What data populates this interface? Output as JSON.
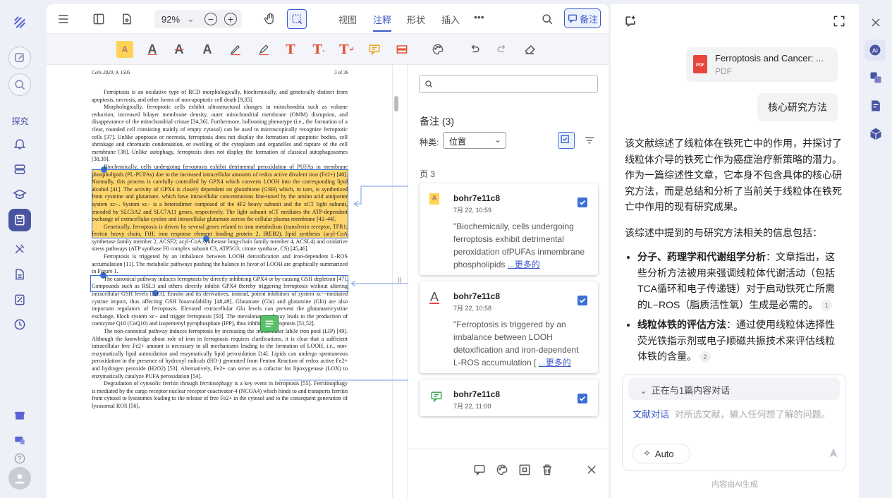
{
  "left_rail": {
    "explore_label": "探究"
  },
  "toolbar": {
    "zoom": "92%",
    "tabs": [
      "视图",
      "注释",
      "形状",
      "插入"
    ],
    "more": "•••",
    "memo_label": "备注"
  },
  "doc": {
    "header_left": "Cells 2020, 9, 1505",
    "header_right": "3 of 26",
    "paragraphs": [
      "Ferroptosis is an oxidative type of RCD morphologically, biochemically, and genetically distinct from apoptosis, necrosis, and other forms of non-apoptotic cell death [9,35].",
      "Morphologically, ferroptotic cells exhibit ultrastructural changes in mitochondria such as volume reduction, increased bilayer membrane density, outer mitochondrial membrane (OMM) disruption, and disappearance of the mitochondrial cristae [34,36]. Furthermore, ballooning phenotype (i.e., the formation of a clear, rounded cell consisting mainly of empty cytosol) can be used to microscopically recognize ferroptotic cells [37]. Unlike apoptosis or necrosis, ferroptosis does not display the formation of apoptotic bodies, cell shrinkage and chromatin condensation, or swelling of the cytoplasm and organelles and rupture of the cell membrane [38]. Unlike autophagy, ferroptosis does not display the formation of classical autophagosomes [38,39].",
      "Biochemically, cells undergoing ferroptosis exhibit detrimental peroxidation of PUFAs in membrane phospholipids (PL-PUFAs) due to the increased intracellular amounts of redox active divalent iron (Fe2+) [40]. Normally, this process is carefully controlled by GPX4 which converts LOOH into the corresponding lipid alcohol [41]. The activity of GPX4 is closely dependent on glutathione (GSH) which, in turn, is synthetized from cysteine and glutamate, which have intracellular concentrations fine-tuned by the amino acid antiporter system xc−. System xc− is a heterodimer composed of the 4F2 heavy subunit and the xCT light subunit, encoded by SLC3A2 and SLC7A11 genes, respectively. The light subunit xCT mediates the ATP-dependent exchange of extracellular cystine and intracellular glutamate across the cellular plasma membrane [42–44].",
      "Genetically, ferroptosis is driven by several genes related to iron metabolism (transferrin receptor, TFR1; ferritin heavy chain, FtH; iron response element binding protein 2, IREB2), lipid synthesis (acyl-CoA synthetase family member 2, ACSF2; acyl-CoA synthetase long-chain family member 4, ACSL4) and oxidative stress pathways (ATP synthase F0 complex subunit C3, ATP5G3; citrate synthase, CS) [45,46].",
      "Ferroptosis is triggered by an imbalance between LOOH detoxification and iron-dependent L-ROS accumulation [11]. The metabolic pathways pushing the balance in favor of LOOH are graphically summarized in Figure 1.",
      "The canonical pathway induces ferroptosis by directly inhibiting GPX4 or by causing GSH depletion [47]. Compounds such as RSL3 and others directly inhibit GPX4 thereby triggering ferroptosis without altering intracellular GSH levels [2,13]. Erastin and its derivatives, instead, potent inhibitors of system xc−-mediated cystine import, thus affecting GSH bioavailability [48,49]. Glutamate (Glu) and glutamine (Gln) are also important regulators of ferroptosis. Elevated extracellular Glu levels can prevent the glutamate/cystine exchange, block system xc− and trigger ferroptosis [50]. The mevalonate pathway leads to the production of coenzyme Q10 (CoQ10) and isopentenyl pyrophosphate (IPP), thus inhibiting ferroptosis [51,52].",
      "The non-canonical pathway induces ferroptosis by increasing the intracellular labile iron pool (LIP) [49]. Although the knowledge about role of iron in ferroptosis requires clarifications, it is clear that a sufficient intracellular free Fe2+ amount is necessary in all mechanisms leading to the formation of LOOH, i.e., non-enzymatically lipid autoxidation and enzymatically lipid peroxidation [14]. Lipids can undergo spontaneous peroxidation in the presence of hydroxyl radicals (HO·) generated from Fenton Reaction of redox active Fe2+ and hydrogen peroxide (H2O2) [53]. Alternatively, Fe2+ can serve as a cofactor for lipoxygenase (LOX) to enzymatically catalyze PUFA peroxidation [54].",
      "Degradation of cytosolic ferritin through ferritinophagy is a key event in ferroptosis [55]. Ferritinophagy is mediated by the cargo receptor nuclear receptor coactivator-4 (NCOA4) which binds to and transports ferritin from cytosol to lysosomes leading to the release of free Fe2+ in the cytosol and to the consequent generation of lysosomal ROS [56]."
    ]
  },
  "annotations": {
    "search_placeholder": "",
    "title": "备注 (3)",
    "filter_label": "种类:",
    "filter_value": "位置",
    "page_label": "页 3",
    "cards": [
      {
        "author": "bohr7e11c8",
        "date": "7月 22, 10:59",
        "quote": "\"Biochemically, cells undergoing ferroptosis exhibit detrimental peroxidation ofPUFAs inmembrane phospholipids ",
        "more": "...更多的",
        "icon": "highlight-icon"
      },
      {
        "author": "bohr7e11c8",
        "date": "7月 22, 10:58",
        "quote": "\"Ferroptosis is triggered by an imbalance between LOOH detoxification and iron-dependent L-ROS accumulation [ ",
        "more": "...更多的",
        "icon": "underline-icon"
      },
      {
        "author": "bohr7e11c8",
        "date": "7月 22, 11:00",
        "quote": "",
        "more": "",
        "icon": "note-icon"
      }
    ]
  },
  "chat": {
    "file_name": "Ferroptosis and Cancer: ...",
    "file_type": "PDF",
    "file_badge": "PDF",
    "user_question": "核心研究方法",
    "answer_p1": "该文献综述了线粒体在铁死亡中的作用，并探讨了线粒体介导的铁死亡作为癌症治疗新策略的潜力。作为一篇综述性文章，它本身不包含具体的核心研究方法，而是总结和分析了当前关于线粒体在铁死亡中作用的现有研究成果。",
    "answer_p2": "该综述中提到的与研究方法相关的信息包括：",
    "bullets": [
      {
        "title": "分子、药理学和代谢组学分析",
        "text": "：文章指出，这些分析方法被用来强调线粒体代谢活动（包括TCA循环和电子传递链）对于启动铁死亡所需的L−ROS（脂质活性氧）生成是必需的。",
        "ref": "1"
      },
      {
        "title": "线粒体铁的评估方法",
        "text": "：通过使用线粒体选择性荧光铁指示剂或电子顺磁共振技术来评估线粒体铁的含量。",
        "ref": "2"
      }
    ],
    "context_label": "正在与1篇内容对话",
    "mode_label": "文献对话",
    "input_placeholder": "对所选文献，输入任何想了解的问题。",
    "auto_label": "Auto",
    "footer": "内容由AI生成"
  },
  "colors": {
    "accent": "#3b58c9",
    "highlight": "#ffc83c",
    "rail_active": "#4a55a2"
  }
}
